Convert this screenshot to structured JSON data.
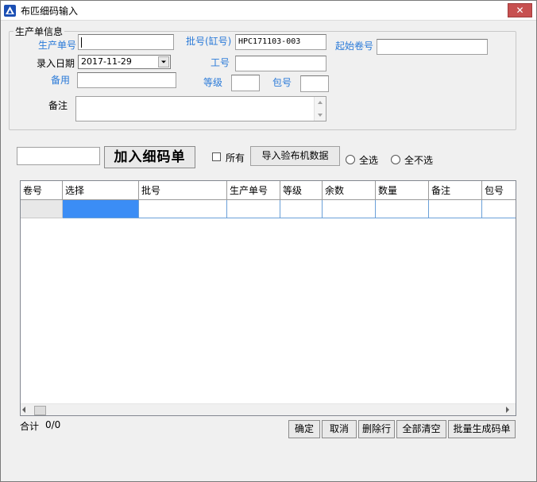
{
  "window": {
    "title": "布匹细码输入",
    "close_glyph": "✕"
  },
  "form": {
    "group_title": "生产单信息",
    "production_order": {
      "label": "生产单号",
      "value": ""
    },
    "batch_no": {
      "label": "批号(缸号)",
      "value": "HPC171103-003"
    },
    "start_roll": {
      "label": "起始卷号",
      "value": ""
    },
    "entry_date": {
      "label": "录入日期",
      "value": "2017-11-29"
    },
    "work_no": {
      "label": "工号",
      "value": ""
    },
    "spare": {
      "label": "备用",
      "value": ""
    },
    "grade": {
      "label": "等级",
      "value": ""
    },
    "package_no": {
      "label": "包号",
      "value": ""
    },
    "remarks": {
      "label": "备注",
      "value": ""
    }
  },
  "toolbar": {
    "code_input_value": "",
    "add_button": "加入细码单",
    "all_checkbox_label": "所有",
    "import_button": "导入验布机数据",
    "select_all_label": "全选",
    "select_none_label": "全不选"
  },
  "grid": {
    "columns": [
      "卷号",
      "选择",
      "批号",
      "生产单号",
      "等级",
      "余数",
      "数量",
      "备注",
      "包号"
    ],
    "rows": [
      [
        "",
        "",
        "",
        "",
        "",
        "",
        "",
        "",
        ""
      ]
    ]
  },
  "footer": {
    "total_label": "合计",
    "total_value": "0/0",
    "buttons": {
      "confirm": "确定",
      "cancel": "取消",
      "delete_row": "删除行",
      "clear_all": "全部清空",
      "batch_generate": "批量生成码单"
    }
  },
  "colors": {
    "label_blue": "#2a7ad8",
    "selection_blue": "#3b8df5",
    "close_red": "#c75050"
  }
}
